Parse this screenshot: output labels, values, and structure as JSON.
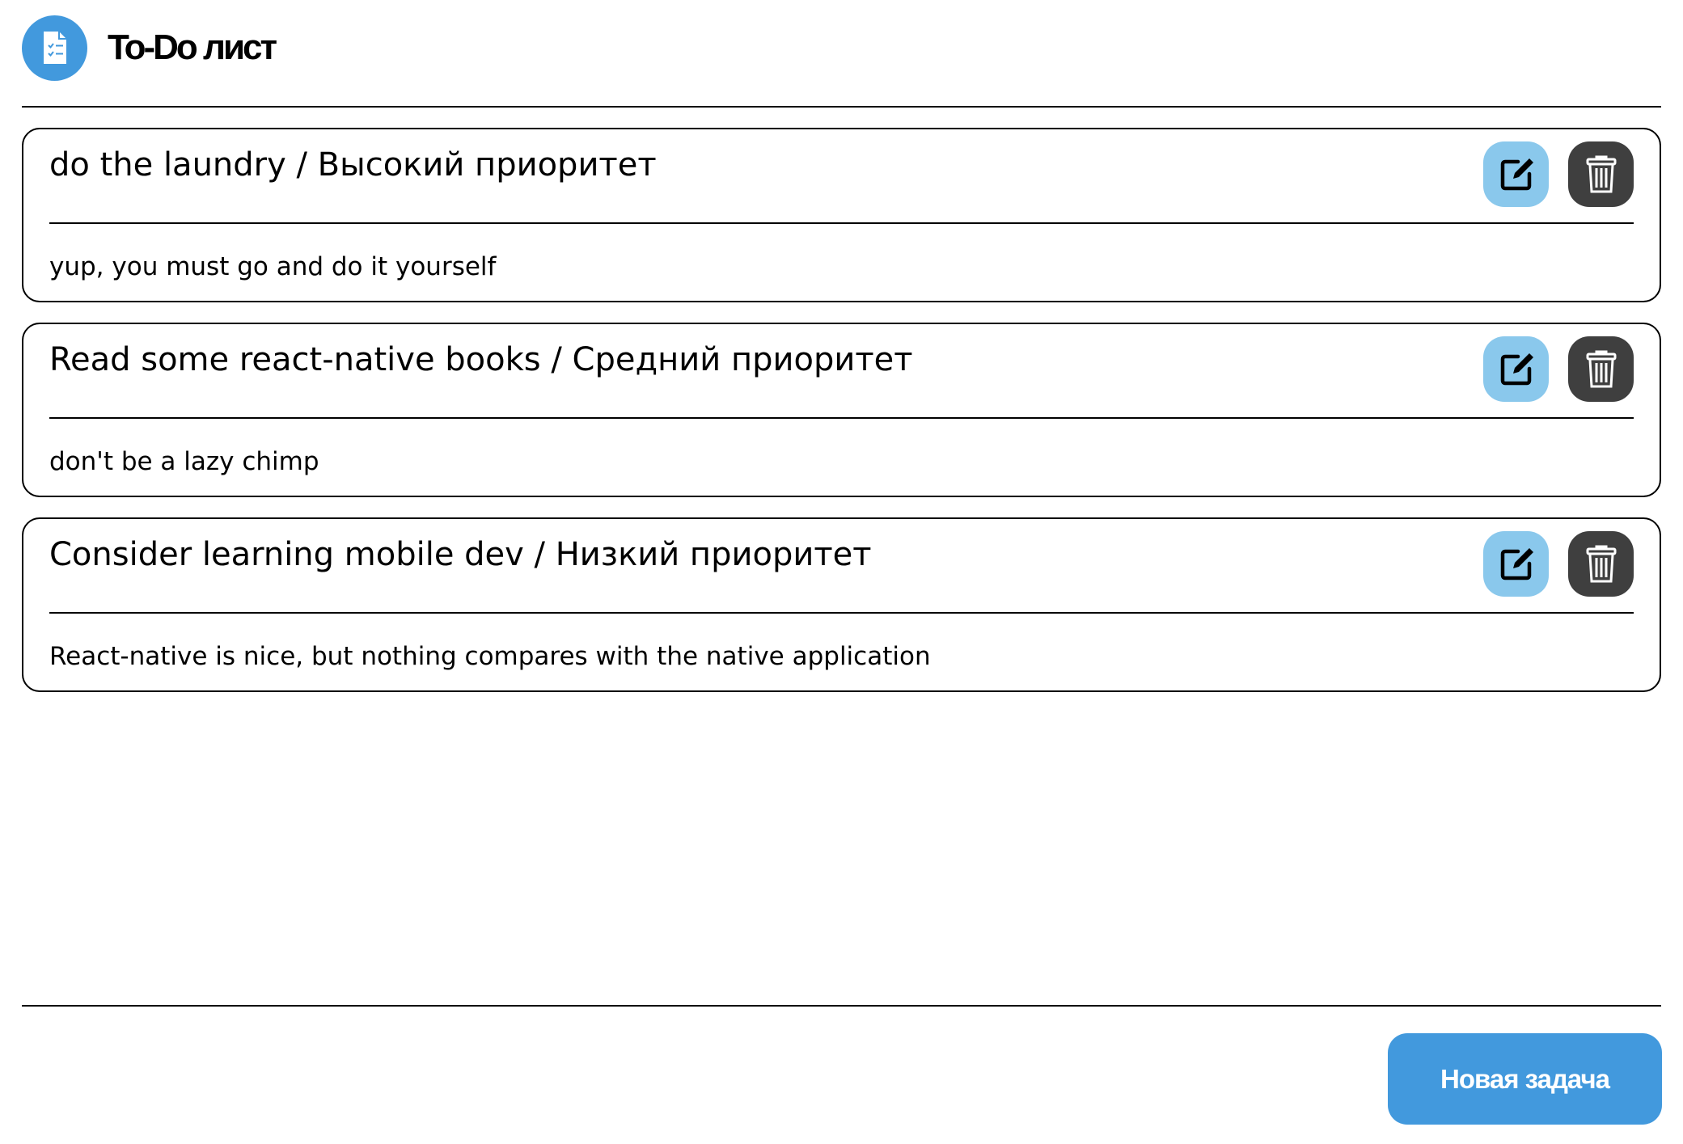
{
  "app": {
    "title": "To-Do лист",
    "logo_icon": "checklist-document-icon",
    "accent_color": "#4299dd"
  },
  "tasks": [
    {
      "title": "do the laundry / Высокий приоритет",
      "description": "yup, you must go and do it yourself"
    },
    {
      "title": "Read some react-native books / Средний приоритет",
      "description": "don't be a lazy chimp"
    },
    {
      "title": "Consider learning mobile dev / Низкий приоритет",
      "description": "React-native is nice, but nothing compares with the native application"
    }
  ],
  "actions": {
    "edit_icon": "edit-icon",
    "edit_color": "#8ac8ec",
    "delete_icon": "trash-icon",
    "delete_color": "#3f3f3f"
  },
  "footer": {
    "new_task_label": "Новая задача"
  }
}
